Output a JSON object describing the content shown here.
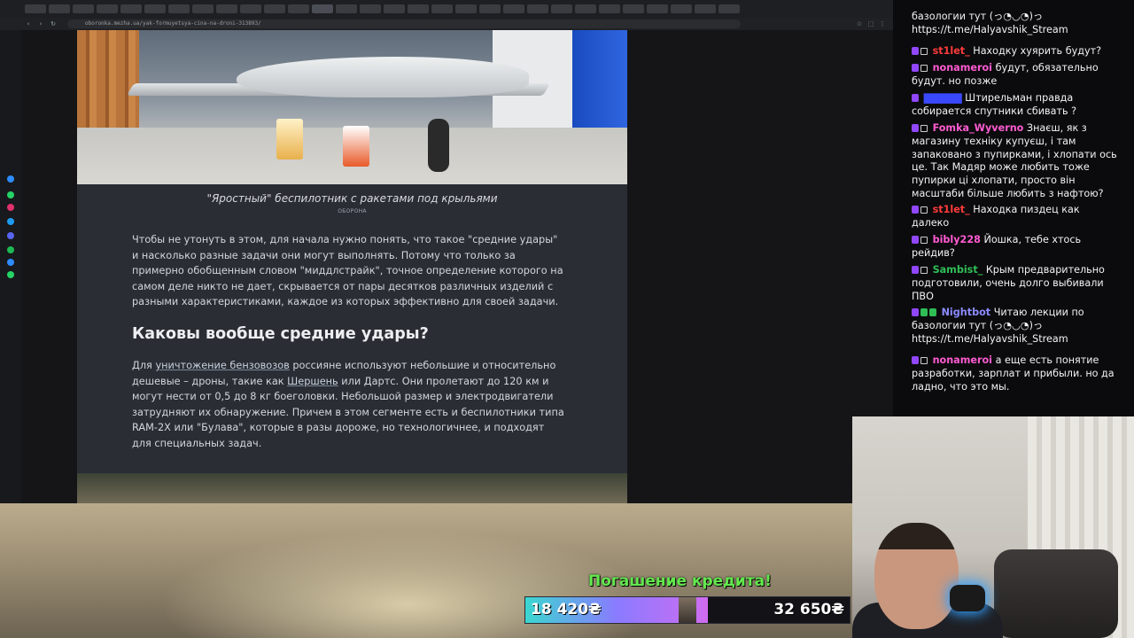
{
  "browser": {
    "address": "oboronka.mezha.ua/yak-formuyetsya-cina-na-droni-313893/",
    "sidebar_colors": [
      "#2d8cff",
      "#25d366",
      "#e1306c",
      "#1d9bf0",
      "#5865f2",
      "#1db954"
    ]
  },
  "article": {
    "image_caption": "\"Яростный\" беспилотник с ракетами под крыльями",
    "image_tag": "ОБОРОНА",
    "paragraph1": "Чтобы не утонуть в этом, для начала нужно понять, что такое \"средние удары\" и насколько разные задачи они могут выполнять. Потому что только за примерно обобщенным словом \"миддлстрайк\", точное определение которого на самом деле никто не дает, скрывается от пары десятков различных изделий с разными характеристиками, каждое из которых эффективно для своей задачи.",
    "heading": "Каковы вообще средние удары?",
    "p2_a": "Для ",
    "p2_link1": "уничтожение бензовозов",
    "p2_b": " россияне используют небольшие и относительно дешевые – дроны, такие как ",
    "p2_link2": "Шершень",
    "p2_c": " или Дартс. Они пролетают до 120 км и могут нести от 0,5 до 8 кг боеголовки. Небольшой размер и электродвигатели затрудняют их обнаружение. Причем в этом сегменте есть и беспилотники типа RAM-2X или \"Булава\", которые в разы дороже, но технологичнее, и подходят для специальных задач."
  },
  "chat": {
    "messages": [
      {
        "user": "",
        "color": "#f2f2f2",
        "text": "базологии тут (っ◔◡◔)っ https://t.me/Halyavshik_Stream"
      },
      {
        "user": "st1let_",
        "color": "#ff3b3b",
        "text": "Находку хуярить будут?"
      },
      {
        "user": "nonameroi",
        "color": "#ff5bd1",
        "text": "будут, обязательно будут. но позже"
      },
      {
        "user": "",
        "color": "#3a49ff",
        "text": "Штирельман правда собирается спутники сбивать ?"
      },
      {
        "user": "Fomka_Wyverno",
        "color": "#ff5bd1",
        "text": "Знаєш, як з магазину техніку купуєш, і там запаковано з пупирками, і хлопати ось це. Так Мадяр може любить тоже пупирки ці хлопати, просто він масштаби більше любить з нафтою?"
      },
      {
        "user": "st1let_",
        "color": "#ff3b3b",
        "text": "Находка пиздец как далеко"
      },
      {
        "user": "bibly228",
        "color": "#ff5bd1",
        "text": "Йошка, тебе хтось рейдив?"
      },
      {
        "user": "Sambist_",
        "color": "#2fbe55",
        "text": "Крым предварительно подготовили, очень долго выбивали ПВО"
      },
      {
        "user": "Nightbot",
        "color": "#8b8bff",
        "text": "Читаю лекции по базологии тут (っ◔◡◔)っ https://t.me/Halyavshik_Stream"
      },
      {
        "user": "nonameroi",
        "color": "#ff5bd1",
        "text": "а еще есть понятие разработки, зарплат и прибыли. но да ладно, что это мы."
      }
    ]
  },
  "goal": {
    "title": "Погашение кредита!",
    "current": "18 420₴",
    "target": "32 650₴",
    "progress": 0.564
  }
}
